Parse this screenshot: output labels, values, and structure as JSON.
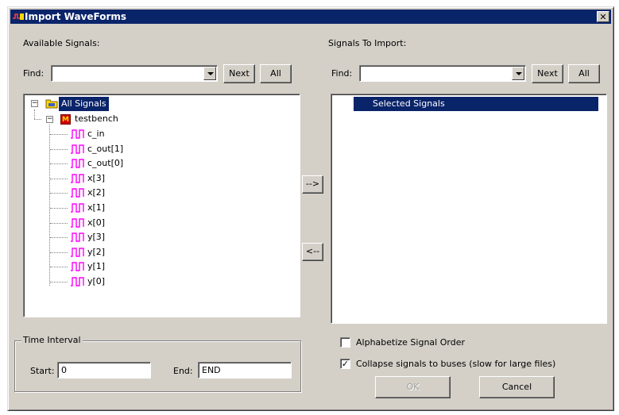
{
  "window": {
    "title": "Import WaveForms",
    "close_glyph": "✕"
  },
  "left_panel": {
    "heading": "Available Signals:",
    "find_label": "Find:",
    "find_value": "",
    "next_label": "Next",
    "all_label": "All",
    "tree": {
      "root_label": "All Signals",
      "module_label": "testbench",
      "module_icon_letter": "M",
      "signals": [
        "c_in",
        "c_out[1]",
        "c_out[0]",
        "x[3]",
        "x[2]",
        "x[1]",
        "x[0]",
        "y[3]",
        "y[2]",
        "y[1]",
        "y[0]"
      ]
    }
  },
  "right_panel": {
    "heading": "Signals To Import:",
    "find_label": "Find:",
    "find_value": "",
    "next_label": "Next",
    "all_label": "All",
    "tree": {
      "root_label": "Selected Signals"
    }
  },
  "transfer": {
    "add_label": "-->",
    "remove_label": "<--"
  },
  "time_interval": {
    "group_label": "Time Interval",
    "start_label": "Start:",
    "start_value": "0",
    "end_label": "End:",
    "end_value": "END"
  },
  "options": {
    "alphabetize_label": "Alphabetize Signal Order",
    "alphabetize_checked": false,
    "collapse_label": "Collapse signals to buses (slow for large files)",
    "collapse_checked": true
  },
  "actions": {
    "ok_label": "OK",
    "cancel_label": "Cancel"
  },
  "colors": {
    "titlebar": "#0a246a",
    "selection": "#0a246a",
    "wave": "#ff00ff",
    "dialog_face": "#d4d0c8"
  }
}
